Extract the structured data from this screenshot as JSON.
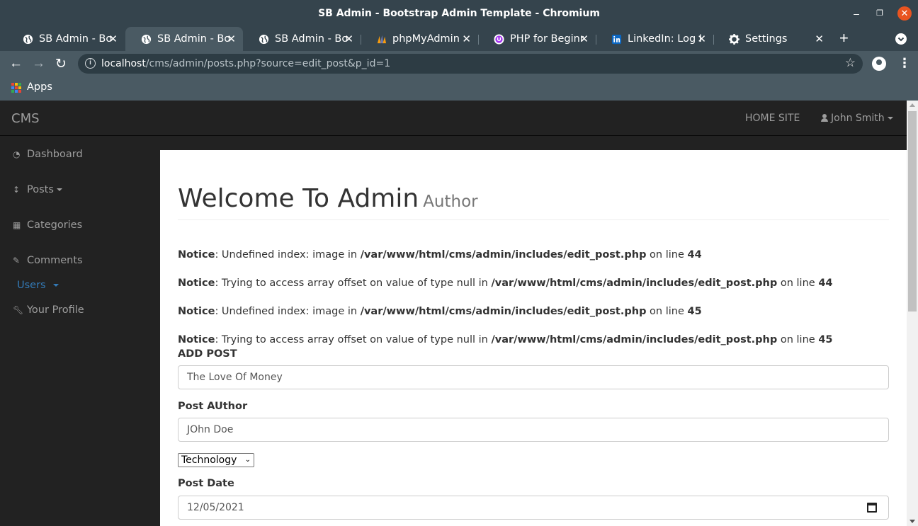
{
  "window": {
    "title": "SB Admin - Bootstrap Admin Template - Chromium"
  },
  "tabs": [
    {
      "label": "SB Admin - Bootstrap",
      "active": false,
      "icon": "globe-icon"
    },
    {
      "label": "SB Admin - Bootstrap",
      "active": true,
      "icon": "globe-icon"
    },
    {
      "label": "SB Admin - Bootstrap",
      "active": false,
      "icon": "globe-icon"
    },
    {
      "label": "phpMyAdmin",
      "active": false,
      "icon": "phpmyadmin-icon"
    },
    {
      "label": "PHP for Beginners",
      "active": false,
      "icon": "udemy-icon"
    },
    {
      "label": "LinkedIn: Log In",
      "active": false,
      "icon": "linkedin-icon"
    },
    {
      "label": "Settings",
      "active": false,
      "icon": "gear-icon"
    }
  ],
  "address": {
    "host": "localhost",
    "path": "/cms/admin/posts.php?source=edit_post&p_id=1"
  },
  "bookmarks": {
    "apps_label": "Apps"
  },
  "topnav": {
    "brand": "CMS",
    "home_site": "HOME SITE",
    "user": "John Smith"
  },
  "sidebar": {
    "items": [
      {
        "label": "Dashboard",
        "icon": "dashboard-icon"
      },
      {
        "label": "Posts",
        "icon": "arrows-v-icon"
      },
      {
        "label": "Categories",
        "icon": "table-icon"
      },
      {
        "label": "Comments",
        "icon": "edit-icon"
      },
      {
        "label": "Users",
        "icon": ""
      },
      {
        "label": "Your Profile",
        "icon": "wrench-icon"
      }
    ]
  },
  "main": {
    "heading": "Welcome To Admin",
    "subheading": "Author",
    "notices": [
      {
        "prefix": "Notice",
        "message": ": Undefined index: image in ",
        "path": "/var/www/html/cms/admin/includes/edit_post.php",
        "online": " on line ",
        "line": "44"
      },
      {
        "prefix": "Notice",
        "message": ": Trying to access array offset on value of type null in ",
        "path": "/var/www/html/cms/admin/includes/edit_post.php",
        "online": " on line ",
        "line": "44"
      },
      {
        "prefix": "Notice",
        "message": ": Undefined index: image in ",
        "path": "/var/www/html/cms/admin/includes/edit_post.php",
        "online": " on line ",
        "line": "45"
      },
      {
        "prefix": "Notice",
        "message": ": Trying to access array offset on value of type null in ",
        "path": "/var/www/html/cms/admin/includes/edit_post.php",
        "online": " on line ",
        "line": "45"
      }
    ],
    "form": {
      "title_label": "ADD POST",
      "title_value": "The Love Of Money",
      "author_label": "Post AUthor",
      "author_value": "JOhn Doe",
      "category_selected": "Technology",
      "date_label": "Post Date",
      "date_value": "12/05/2021"
    }
  },
  "colors": {
    "navbar_bg": "#222222",
    "link_blue": "#337ab7",
    "chrome_frame": "#35444d",
    "close_button": "#e95420"
  }
}
